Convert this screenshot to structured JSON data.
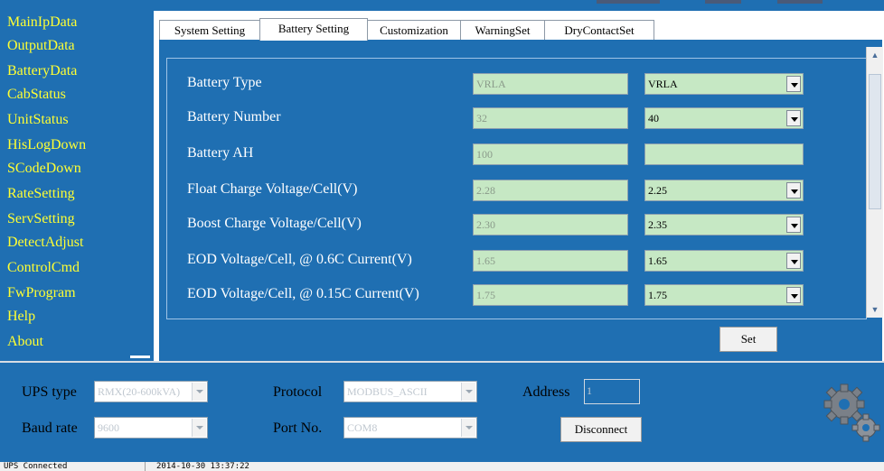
{
  "sidebar": {
    "items": [
      "MainIpData",
      "OutputData",
      "BatteryData",
      "CabStatus",
      "UnitStatus",
      "HisLogDown",
      "SCodeDown",
      "RateSetting",
      "ServSetting",
      "DetectAdjust",
      "ControlCmd",
      "FwProgram",
      "Help",
      "About"
    ]
  },
  "tabs": [
    "System Setting",
    "Battery Setting",
    "Customization",
    "WarningSet",
    "DryContactSet"
  ],
  "active_tab": "Battery Setting",
  "battery_settings": {
    "rows": [
      {
        "label": "Battery Type",
        "current": "VRLA",
        "selected": "VRLA"
      },
      {
        "label": "Battery Number",
        "current": "32",
        "selected": "40"
      },
      {
        "label": "Battery AH",
        "current": "100",
        "selected": ""
      },
      {
        "label": "Float Charge Voltage/Cell(V)",
        "current": "2.28",
        "selected": "2.25"
      },
      {
        "label": "Boost Charge Voltage/Cell(V)",
        "current": "2.30",
        "selected": "2.35"
      },
      {
        "label": "EOD Voltage/Cell, @ 0.6C Current(V)",
        "current": "1.65",
        "selected": "1.65"
      },
      {
        "label": "EOD Voltage/Cell, @ 0.15C Current(V)",
        "current": "1.75",
        "selected": "1.75"
      }
    ],
    "set_label": "Set"
  },
  "connection": {
    "ups_type_label": "UPS type",
    "ups_type_value": "RMX(20-600kVA)",
    "baud_rate_label": "Baud rate",
    "baud_rate_value": "9600",
    "protocol_label": "Protocol",
    "protocol_value": "MODBUS_ASCII",
    "port_label": "Port No.",
    "port_value": "COM8",
    "address_label": "Address",
    "address_value": "1",
    "disconnect_label": "Disconnect"
  },
  "status_bar": {
    "connection": "UPS Connected",
    "timestamp": "2014-10-30 13:37:22"
  },
  "colors": {
    "background": "#1f6fb2",
    "sidebar_text": "#ffff33",
    "field_green": "#c6e8c4"
  },
  "icons": [
    "gear-icon",
    "chevron-down-icon",
    "scroll-up-icon",
    "scroll-down-icon"
  ]
}
